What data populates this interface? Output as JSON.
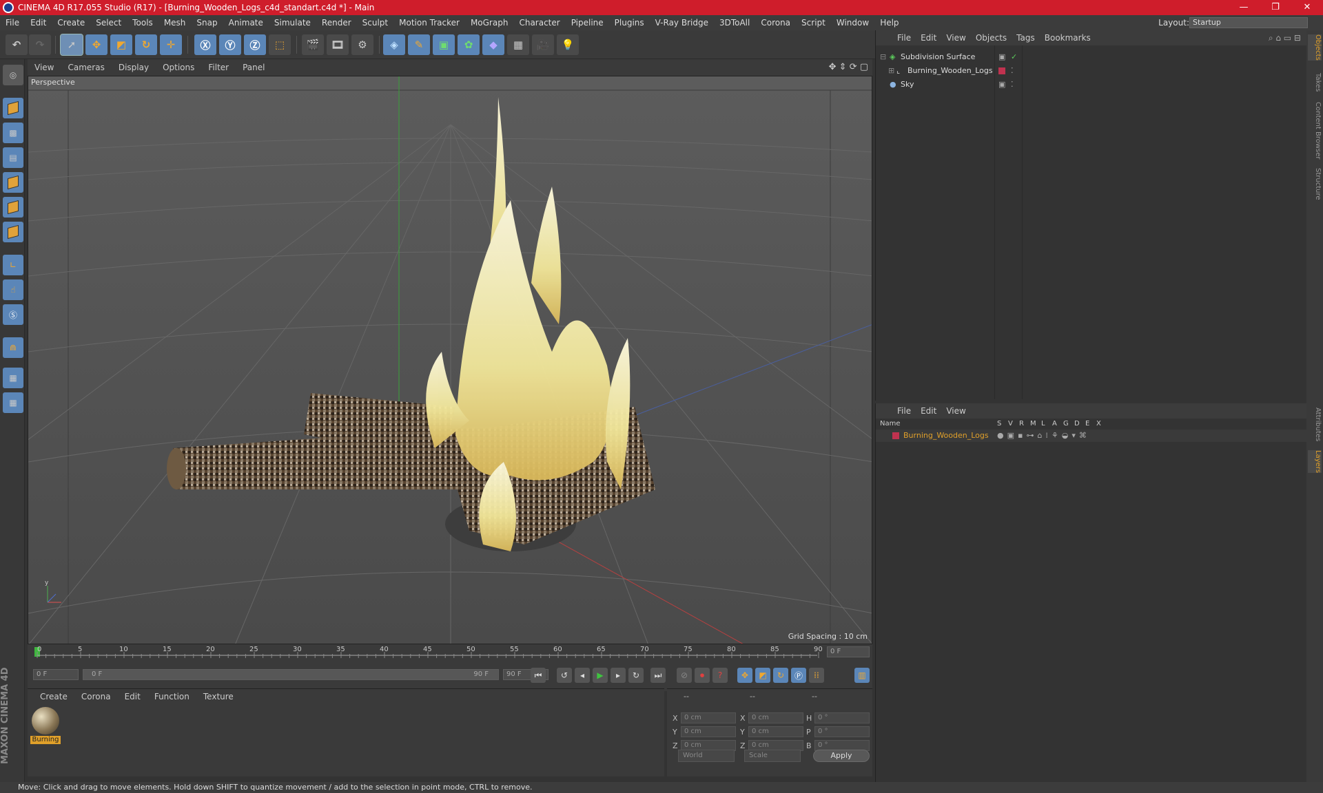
{
  "window": {
    "title": "CINEMA 4D R17.055 Studio (R17) - [Burning_Wooden_Logs_c4d_standart.c4d *] - Main"
  },
  "menu": [
    "File",
    "Edit",
    "Create",
    "Select",
    "Tools",
    "Mesh",
    "Snap",
    "Animate",
    "Simulate",
    "Render",
    "Sculpt",
    "Motion Tracker",
    "MoGraph",
    "Character",
    "Pipeline",
    "Plugins",
    "V-Ray Bridge",
    "3DToAll",
    "Corona",
    "Script",
    "Window",
    "Help"
  ],
  "layout": {
    "label": "Layout:",
    "value": "Startup"
  },
  "viewport": {
    "menu": [
      "View",
      "Cameras",
      "Display",
      "Options",
      "Filter",
      "Panel"
    ],
    "label": "Perspective",
    "grid_spacing": "Grid Spacing : 10 cm"
  },
  "timeline": {
    "ticks": [
      "0",
      "5",
      "10",
      "15",
      "20",
      "25",
      "30",
      "35",
      "40",
      "45",
      "50",
      "55",
      "60",
      "65",
      "70",
      "75",
      "80",
      "85",
      "90"
    ],
    "end_field": "0 F"
  },
  "transport": {
    "current": "0 F",
    "range_start": "0 F",
    "range_end": "90 F",
    "max": "90 F"
  },
  "material_manager": {
    "menu": [
      "Create",
      "Corona",
      "Edit",
      "Function",
      "Texture"
    ],
    "materials": [
      {
        "name": "Burning"
      }
    ]
  },
  "coordinates": {
    "headers": [
      "--",
      "--",
      "--"
    ],
    "rows": [
      {
        "a": "X",
        "av": "0 cm",
        "b": "X",
        "bv": "0 cm",
        "c": "H",
        "cv": "0 °"
      },
      {
        "a": "Y",
        "av": "0 cm",
        "b": "Y",
        "bv": "0 cm",
        "c": "P",
        "cv": "0 °"
      },
      {
        "a": "Z",
        "av": "0 cm",
        "b": "Z",
        "bv": "0 cm",
        "c": "B",
        "cv": "0 °"
      }
    ],
    "mode": "World",
    "size_mode": "Scale",
    "apply": "Apply"
  },
  "object_manager": {
    "menu": [
      "File",
      "Edit",
      "View",
      "Objects",
      "Tags",
      "Bookmarks"
    ],
    "objects": [
      {
        "name": "Subdivision Surface",
        "icon": "subdivision-icon"
      },
      {
        "name": "Burning_Wooden_Logs",
        "icon": "null-object-icon"
      },
      {
        "name": "Sky",
        "icon": "sky-icon"
      }
    ]
  },
  "layer_manager": {
    "menu": [
      "File",
      "Edit",
      "View"
    ],
    "columns": [
      "Name",
      "S",
      "V",
      "R",
      "M",
      "L",
      "A",
      "G",
      "D",
      "E",
      "X"
    ],
    "layers": [
      {
        "name": "Burning_Wooden_Logs",
        "color": "#c0324f"
      }
    ]
  },
  "right_tabs": [
    "Objects",
    "Takes",
    "Content Browser",
    "Structure",
    "Attributes",
    "Layers"
  ],
  "brand": "MAXON CINEMA 4D",
  "status": "Move: Click and drag to move elements. Hold down SHIFT to quantize movement / add to the selection in point mode, CTRL to remove.",
  "colors": {
    "accent": "#e0a02a",
    "titlebar": "#cf1d2b",
    "tool_blue": "#5b86b8"
  }
}
